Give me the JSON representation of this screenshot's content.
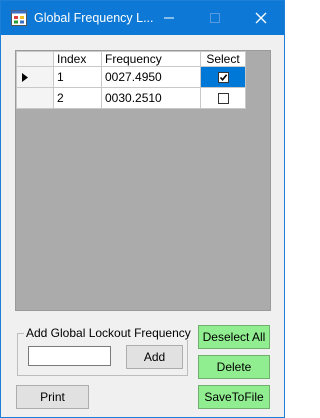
{
  "window": {
    "title": "Global Frequency L...",
    "icon": "form-app-icon",
    "controls": [
      "minimize-icon",
      "maximize-icon",
      "close-icon"
    ]
  },
  "grid": {
    "columns": [
      "Index",
      "Frequency",
      "Select"
    ],
    "rows": [
      {
        "index": "1",
        "frequency": "0027.4950",
        "selected": true,
        "current": true
      },
      {
        "index": "2",
        "frequency": "0030.2510",
        "selected": false,
        "current": false
      }
    ],
    "colors": {
      "selection": "#0078d7",
      "empty_area": "#ababab"
    }
  },
  "lockout_group": {
    "legend": "Add Global Lockout Frequency",
    "input_value": "",
    "add_label": "Add"
  },
  "buttons": {
    "deselect_all": "Deselect All",
    "delete": "Delete",
    "save_to_file": "SaveToFile",
    "print": "Print",
    "accent_color": "#90ee90"
  }
}
